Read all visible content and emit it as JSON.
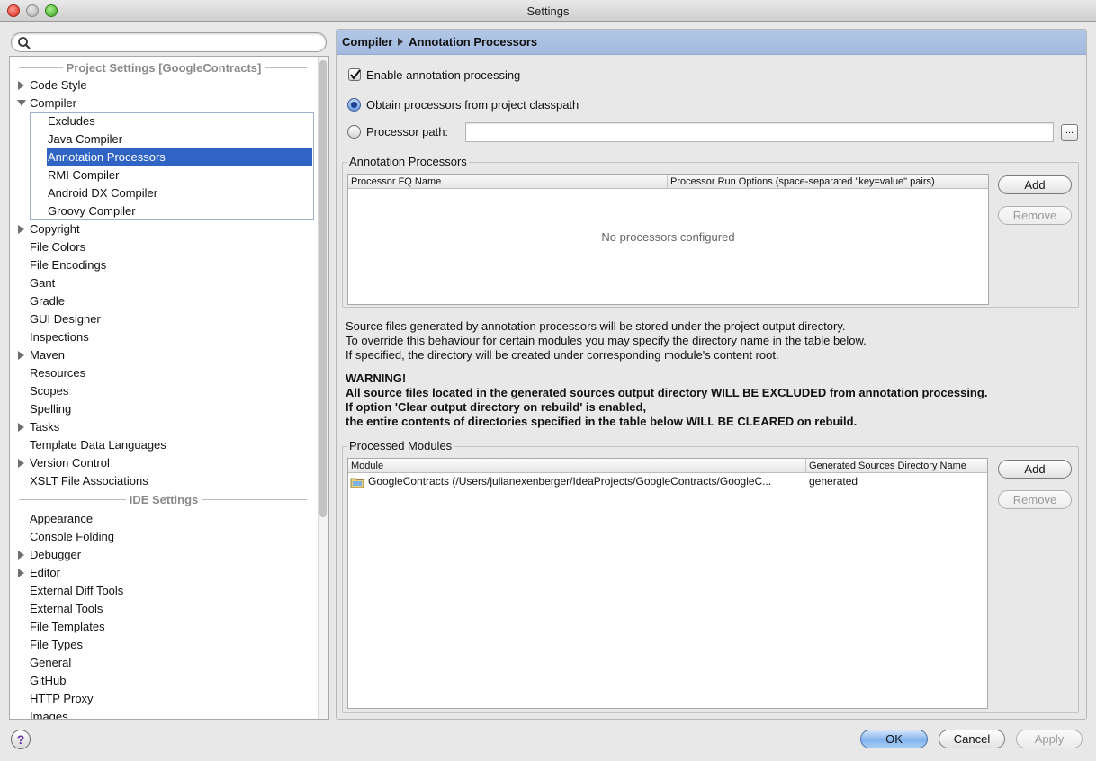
{
  "window": {
    "title": "Settings"
  },
  "search": {
    "placeholder": ""
  },
  "sidebar": {
    "project_header": "Project Settings [GoogleContracts]",
    "ide_header": "IDE Settings",
    "items": {
      "code_style": "Code Style",
      "compiler": "Compiler",
      "excludes": "Excludes",
      "java_compiler": "Java Compiler",
      "annotation_processors": "Annotation Processors",
      "rmi_compiler": "RMI Compiler",
      "android_dx_compiler": "Android DX Compiler",
      "groovy_compiler": "Groovy Compiler",
      "copyright": "Copyright",
      "file_colors": "File Colors",
      "file_encodings": "File Encodings",
      "gant": "Gant",
      "gradle": "Gradle",
      "gui_designer": "GUI Designer",
      "inspections": "Inspections",
      "maven": "Maven",
      "resources": "Resources",
      "scopes": "Scopes",
      "spelling": "Spelling",
      "tasks": "Tasks",
      "template_data_languages": "Template Data Languages",
      "version_control": "Version Control",
      "xslt_file_associations": "XSLT File Associations",
      "appearance": "Appearance",
      "console_folding": "Console Folding",
      "debugger": "Debugger",
      "editor": "Editor",
      "external_diff_tools": "External Diff Tools",
      "external_tools": "External Tools",
      "file_templates": "File Templates",
      "file_types": "File Types",
      "general": "General",
      "github": "GitHub",
      "http_proxy": "HTTP Proxy",
      "images": "Images"
    }
  },
  "breadcrumb": {
    "parent": "Compiler",
    "current": "Annotation Processors"
  },
  "options": {
    "enable_processing": "Enable annotation processing",
    "enable_processing_checked": true,
    "obtain_from_classpath": "Obtain processors from project classpath",
    "processor_path": "Processor path:",
    "processor_path_value": "",
    "browse": "..."
  },
  "annotation_processors": {
    "title": "Annotation Processors",
    "columns": [
      "Processor FQ Name",
      "Processor Run Options (space-separated \"key=value\" pairs)"
    ],
    "empty_text": "No processors configured",
    "add": "Add",
    "remove": "Remove"
  },
  "info": {
    "line1": "Source files generated by annotation processors will be stored under the project output directory.",
    "line2": "To override this behaviour for certain modules you may specify the directory name in the table below.",
    "line3": "If specified, the directory will be created under corresponding module's content root.",
    "warn1": "WARNING!",
    "warn2": "All source files located in the generated sources output directory WILL BE EXCLUDED from annotation processing.",
    "warn3": "If option 'Clear output directory on rebuild' is enabled,",
    "warn4": "the entire contents of directories specified in the table below WILL BE CLEARED on rebuild."
  },
  "processed_modules": {
    "title": "Processed Modules",
    "columns": [
      "Module",
      "Generated Sources Directory Name"
    ],
    "rows": [
      {
        "module": "GoogleContracts (/Users/julianexenberger/IdeaProjects/GoogleContracts/GoogleC...",
        "dir": "generated",
        "icon": "folder-icon"
      }
    ],
    "add": "Add",
    "remove": "Remove"
  },
  "footer": {
    "help": "?",
    "ok": "OK",
    "cancel": "Cancel",
    "apply": "Apply"
  },
  "colors": {
    "selection": "#2f64c4",
    "header": "#a9bfe3"
  }
}
